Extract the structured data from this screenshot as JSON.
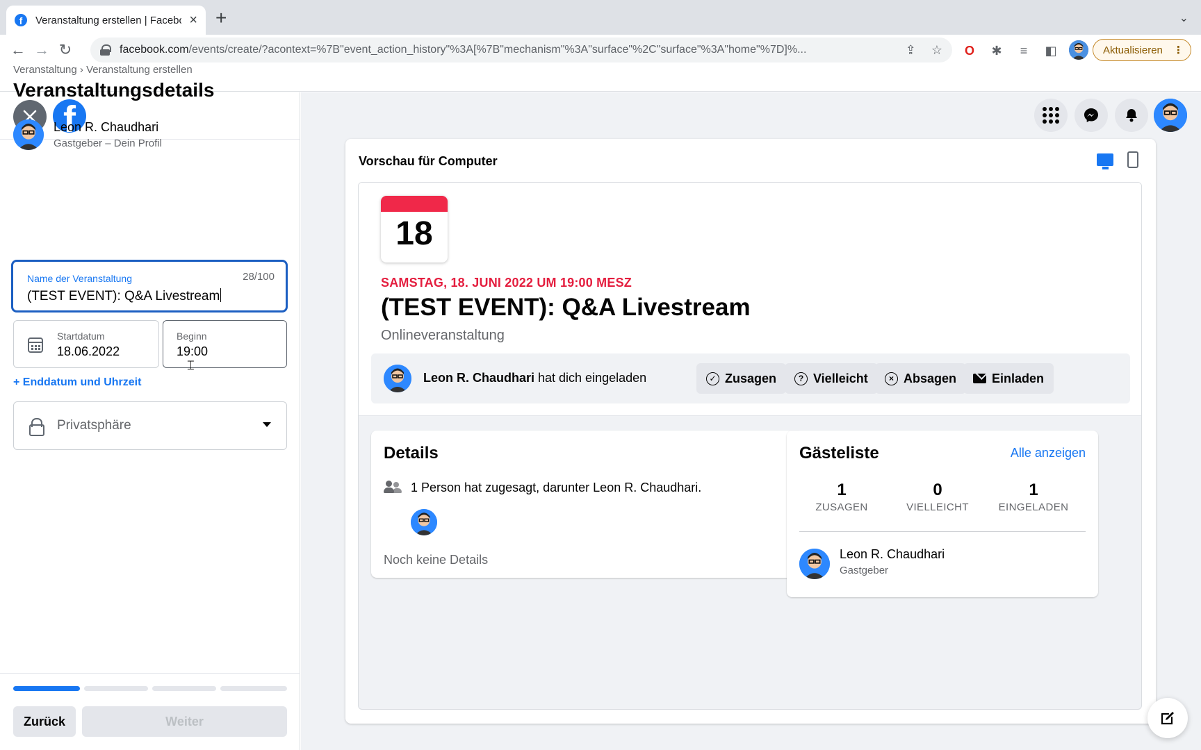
{
  "browser": {
    "tab_title": "Veranstaltung erstellen | Facebook",
    "url_host": "facebook.com",
    "url_path": "/events/create/?acontext=%7B\"event_action_history\"%3A[%7B\"mechanism\"%3A\"surface\"%2C\"surface\"%3A\"home\"%7D]%...",
    "update_label": "Aktualisieren",
    "favicon_letter": "f"
  },
  "left": {
    "breadcrumb": "Veranstaltung › Veranstaltung erstellen",
    "title": "Veranstaltungsdetails",
    "host": {
      "name": "Leon R. Chaudhari",
      "role": "Gastgeber – Dein Profil"
    },
    "name_field": {
      "label": "Name der Veranstaltung",
      "counter": "28/100",
      "value": "(TEST EVENT): Q&A Livestream"
    },
    "date_field": {
      "label": "Startdatum",
      "value": "18.06.2022"
    },
    "time_field": {
      "label": "Beginn",
      "value": "19:00"
    },
    "end_link": "+ Enddatum und Uhrzeit",
    "privacy_field": {
      "value": "Privatsphäre"
    },
    "progress_step": 1,
    "progress_total": 4,
    "back_label": "Zurück",
    "next_label": "Weiter"
  },
  "preview": {
    "title": "Vorschau für Computer",
    "calendar_day": "18",
    "date_line": "SAMSTAG, 18. JUNI 2022 UM 19:00 MESZ",
    "event_name": "(TEST EVENT): Q&A Livestream",
    "event_type": "Onlineveranstaltung",
    "invite": {
      "host": "Leon R. Chaudhari",
      "text": " hat dich eingeladen"
    },
    "buttons": {
      "going": "Zusagen",
      "maybe": "Vielleicht",
      "decline": "Absagen",
      "invite": "Einladen"
    },
    "details": {
      "title": "Details",
      "summary": "1 Person hat zugesagt, darunter Leon R. Chaudhari.",
      "empty": "Noch keine Details"
    },
    "guests": {
      "title": "Gästeliste",
      "show_all": "Alle anzeigen",
      "stats": [
        {
          "num": "1",
          "label": "ZUSAGEN"
        },
        {
          "num": "0",
          "label": "VIELLEICHT"
        },
        {
          "num": "1",
          "label": "EINGELADEN"
        }
      ],
      "host_name": "Leon R. Chaudhari",
      "host_role": "Gastgeber"
    }
  },
  "colors": {
    "fb_blue": "#1877f2",
    "date_red": "#e41e3f",
    "calendar_red": "#f02849",
    "background": "#f0f2f5"
  }
}
